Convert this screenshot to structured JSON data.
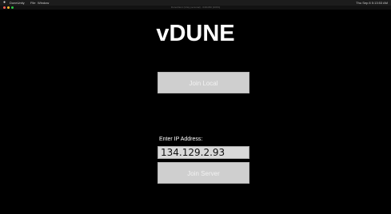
{
  "window": {
    "title": "DuneClient (Unity personal) - 640x360 [100%]"
  },
  "menubar": {
    "app_name": "DuneUnity",
    "items": [
      "File",
      "Window"
    ],
    "status_text": "Thu Sep 8 5:13:53 AM"
  },
  "game": {
    "title": "vDUNE",
    "join_local_label": "Join Local",
    "ip_label": "Enter IP Address:",
    "ip_value": "134.129.2.93",
    "join_server_label": "Join Server"
  },
  "colors": {
    "background": "#000000",
    "button_fill": "#cfcfcf",
    "button_text": "#f2f2f2",
    "title_text": "#ffffff"
  }
}
